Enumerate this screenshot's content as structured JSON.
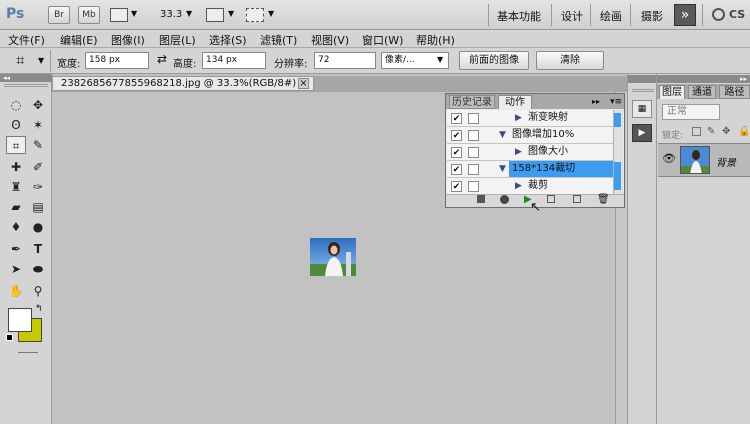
{
  "app": {
    "logo": "Ps",
    "br": "Br",
    "mb": "Mb",
    "zoom": "33.3",
    "workspaces": [
      "基本功能",
      "设计",
      "绘画",
      "摄影"
    ],
    "more": "»",
    "cs": "CS"
  },
  "menu": [
    "文件(F)",
    "编辑(E)",
    "图像(I)",
    "图层(L)",
    "选择(S)",
    "滤镜(T)",
    "视图(V)",
    "窗口(W)",
    "帮助(H)"
  ],
  "options": {
    "width_label": "宽度:",
    "width_value": "158 px",
    "swap": "⇄",
    "height_label": "高度:",
    "height_value": "134 px",
    "res_label": "分辨率:",
    "res_value": "72",
    "unit": "像素/...",
    "front_image": "前面的图像",
    "clear": "清除"
  },
  "document": {
    "tab_title": "2382685677855968218.jpg @ 33.3%(RGB/8#) *",
    "close": "×"
  },
  "actions_panel": {
    "tabs": [
      "历史记录",
      "动作"
    ],
    "rows": [
      {
        "label": "渐变映射",
        "indent": 1,
        "expanded": false,
        "checked": true,
        "highlighted": false
      },
      {
        "label": "图像增加10%",
        "indent": 0,
        "expanded": true,
        "checked": true,
        "highlighted": false
      },
      {
        "label": "图像大小",
        "indent": 1,
        "expanded": false,
        "checked": true,
        "highlighted": false
      },
      {
        "label": "158*134裁切",
        "indent": 0,
        "expanded": true,
        "checked": true,
        "highlighted": true
      },
      {
        "label": "裁剪",
        "indent": 1,
        "expanded": false,
        "checked": true,
        "highlighted": false
      }
    ]
  },
  "layers_panel": {
    "tabs": [
      "图层",
      "通道",
      "路径"
    ],
    "blend_mode": "正常",
    "lock_label": "锁定:",
    "layer_name": "背景"
  },
  "colors": {
    "foreground": "#ffffff",
    "background": "#c8c800",
    "highlight": "#3b9cf0"
  }
}
